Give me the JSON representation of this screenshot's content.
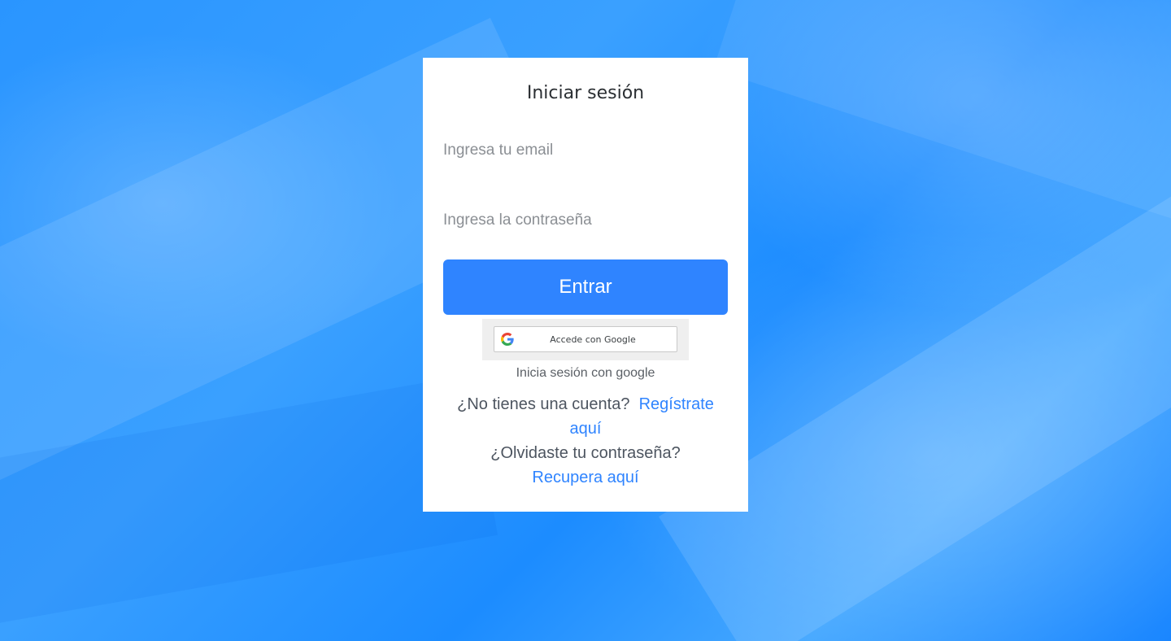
{
  "login": {
    "title": "Iniciar sesión",
    "email_placeholder": "Ingresa tu email",
    "email_value": "",
    "password_placeholder": "Ingresa la contraseña",
    "password_value": "",
    "submit_label": "Entrar",
    "google_button_label": "Accede con Google",
    "google_caption": "Inicia sesión con google",
    "no_account_text": "¿No tienes una cuenta?",
    "register_link": "Regístrate aquí",
    "forgot_text": "¿Olvidaste tu contraseña?",
    "recover_link": "Recupera aquí"
  },
  "icons": {
    "google": "google-g-icon"
  },
  "colors": {
    "primary": "#2f84ff",
    "background": "#1e8fff",
    "card": "#ffffff"
  }
}
